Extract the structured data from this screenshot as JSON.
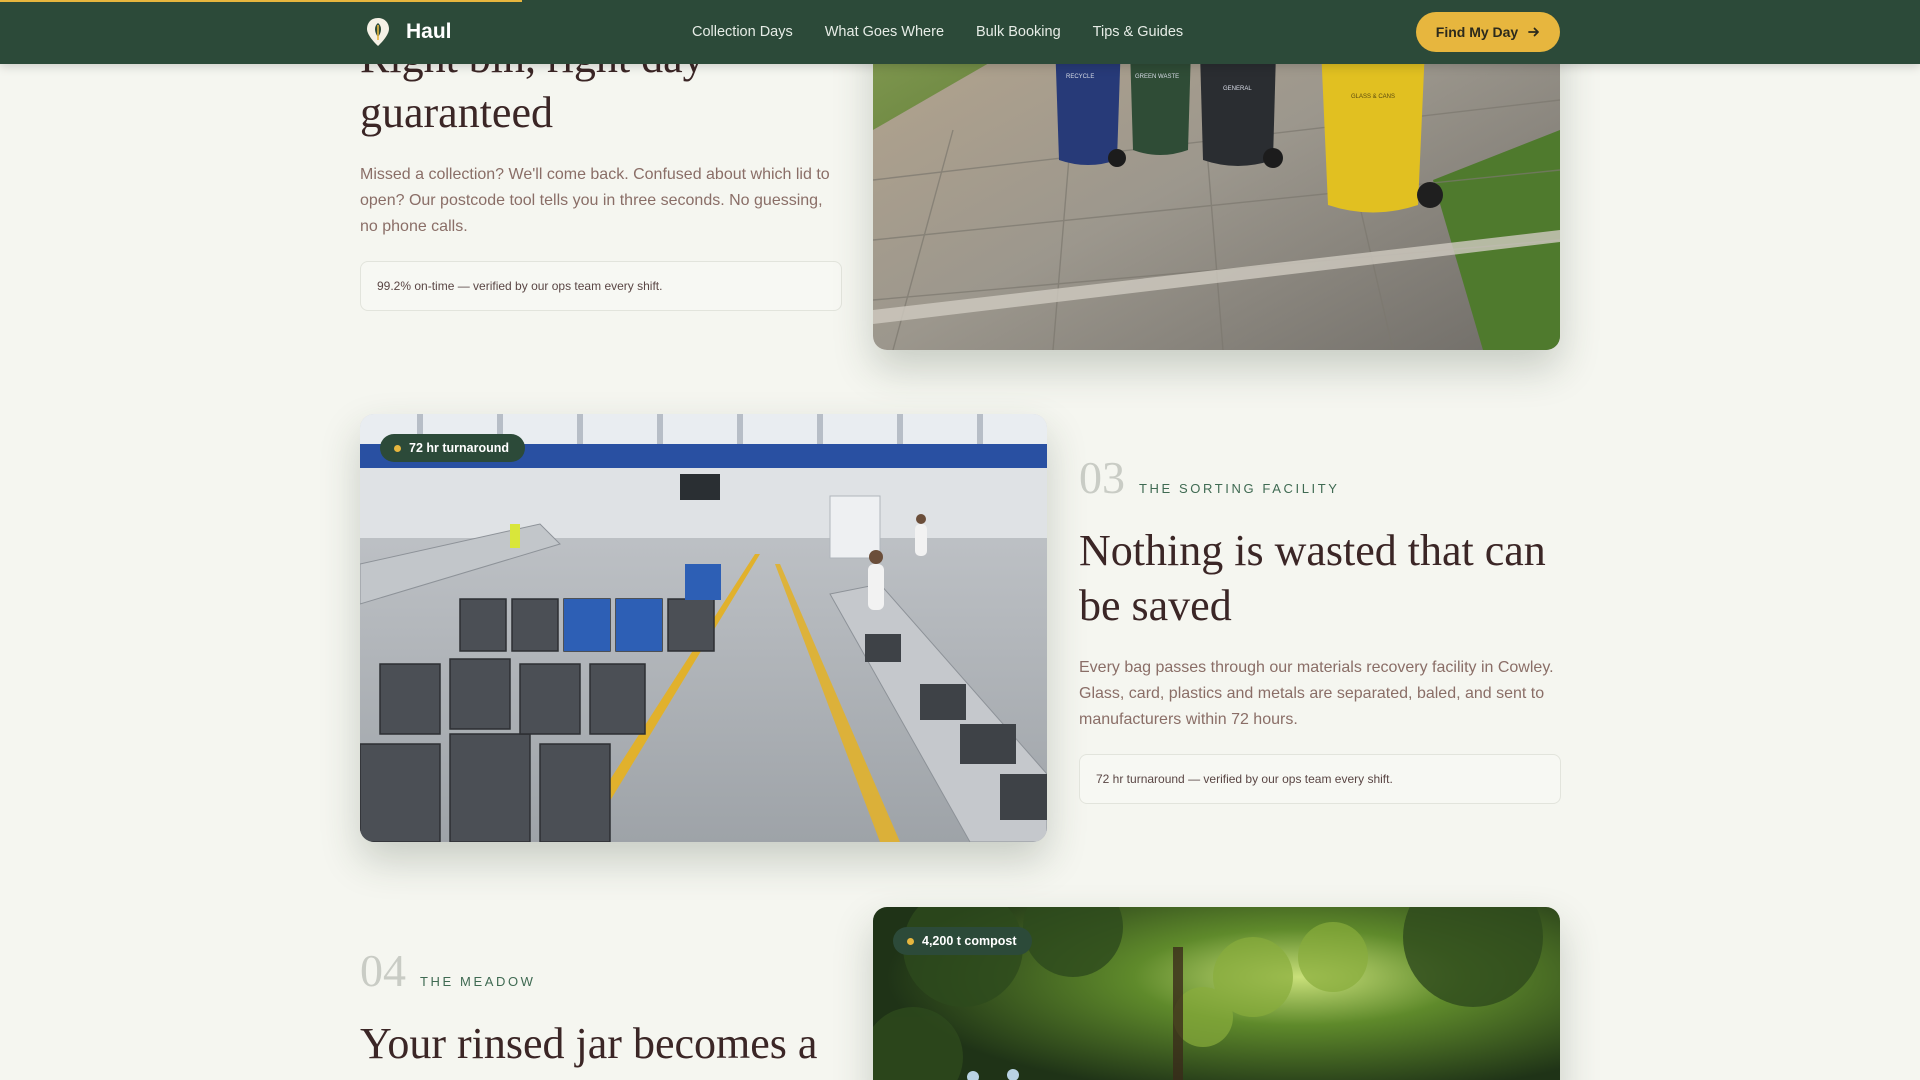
{
  "header": {
    "brand": "Haul",
    "nav": [
      "Collection Days",
      "What Goes Where",
      "Bulk Booking",
      "Tips & Guides"
    ],
    "cta_label": "Find My Day",
    "scroll_progress": 0.272
  },
  "sections": [
    {
      "title": "Right bin, right day guaranteed",
      "body": "Missed a collection? We'll come back. Confused about which lid to open? Our postcode tool tells you in three seconds. No guessing, no phone calls.",
      "note": "99.2% on-time — verified by our ops team every shift.",
      "bin_labels": [
        "RECYCLE",
        "GREEN WASTE",
        "GENERAL",
        "GLASS & CANS"
      ]
    },
    {
      "number": "03",
      "eyebrow": "THE SORTING FACILITY",
      "title": "Nothing is wasted that can be saved",
      "body": "Every bag passes through our materials recovery facility in Cowley. Glass, card, plastics and metals are separated, baled, and sent to manufacturers within 72 hours.",
      "note": "72 hr turnaround — verified by our ops team every shift.",
      "badge": "72 hr turnaround"
    },
    {
      "number": "04",
      "eyebrow": "THE MEADOW",
      "title": "Your rinsed jar becomes a",
      "badge": "4,200 t compost"
    }
  ],
  "colors": {
    "header_bg": "#2c4a39",
    "accent": "#e7b63e",
    "page_bg": "#f5f6f0",
    "eyebrow": "#3f6a52"
  }
}
